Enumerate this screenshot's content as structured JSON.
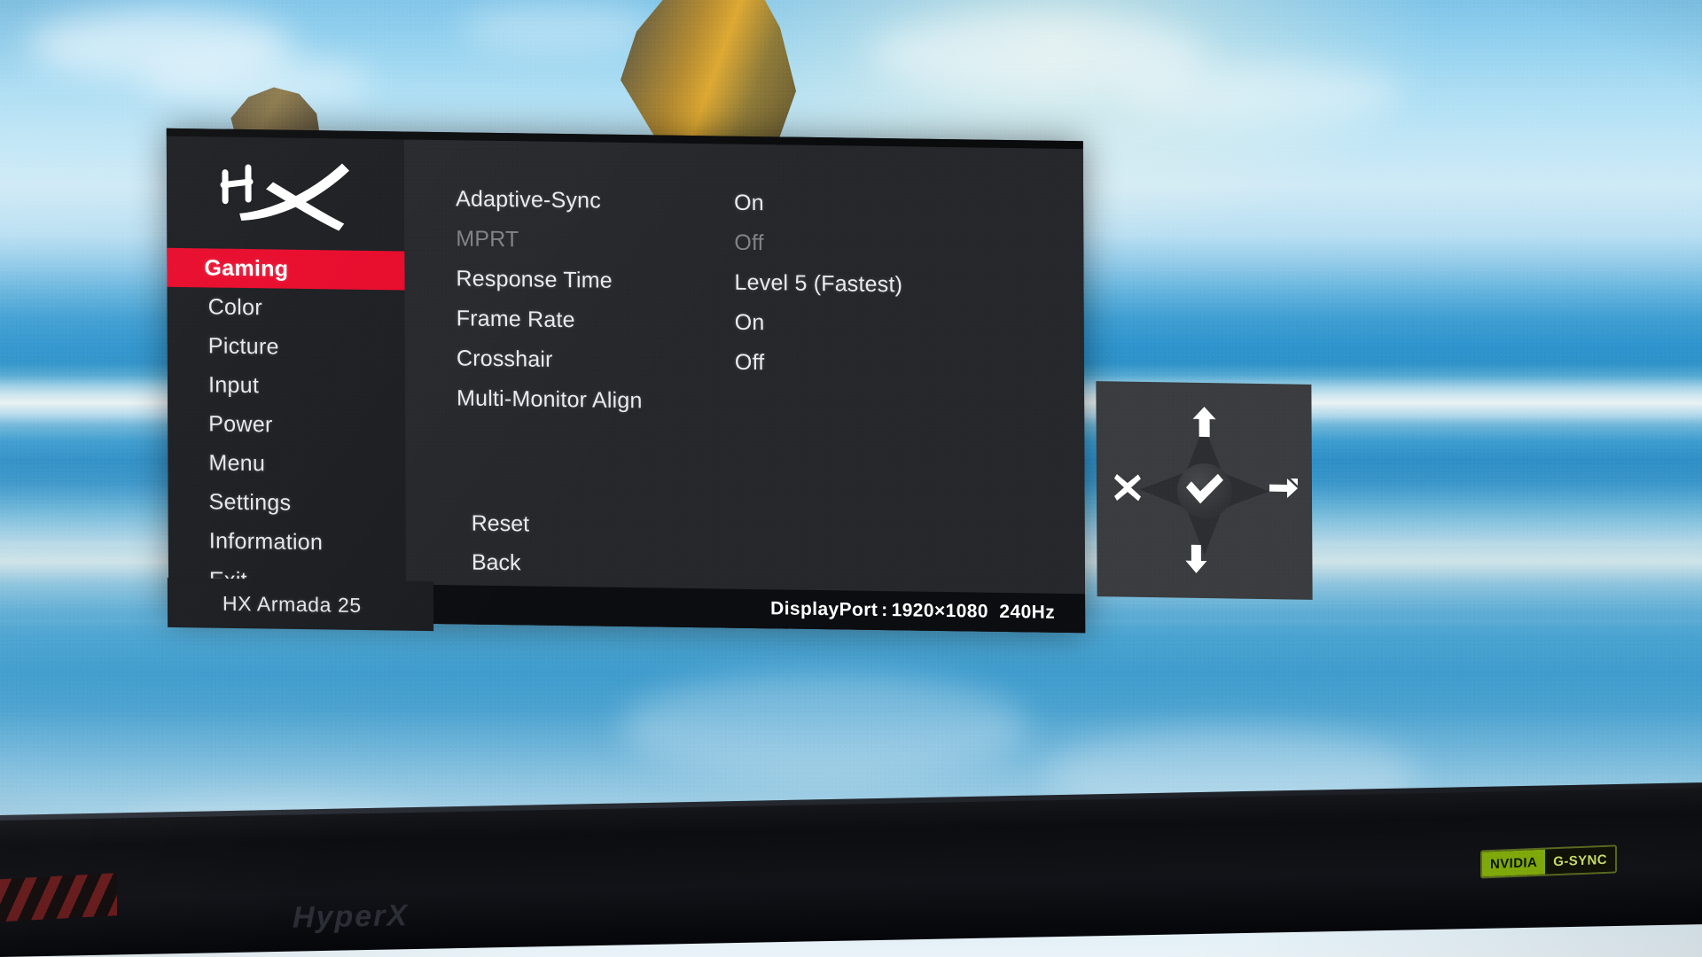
{
  "device": {
    "brand": "HyperX",
    "model_label": "HX Armada 25"
  },
  "sidebar": {
    "items": [
      {
        "label": "Gaming",
        "active": true
      },
      {
        "label": "Color",
        "active": false
      },
      {
        "label": "Picture",
        "active": false
      },
      {
        "label": "Input",
        "active": false
      },
      {
        "label": "Power",
        "active": false
      },
      {
        "label": "Menu",
        "active": false
      },
      {
        "label": "Settings",
        "active": false
      },
      {
        "label": "Information",
        "active": false
      },
      {
        "label": "Exit",
        "active": false
      }
    ]
  },
  "main": {
    "rows": [
      {
        "label": "Adaptive-Sync",
        "value": "On",
        "disabled": false
      },
      {
        "label": "MPRT",
        "value": "Off",
        "disabled": true
      },
      {
        "label": "Response Time",
        "value": "Level 5 (Fastest)",
        "disabled": false
      },
      {
        "label": "Frame Rate",
        "value": "On",
        "disabled": false
      },
      {
        "label": "Crosshair",
        "value": "Off",
        "disabled": false
      },
      {
        "label": "Multi-Monitor Align",
        "value": "",
        "disabled": false
      }
    ],
    "actions": [
      {
        "label": "Reset"
      },
      {
        "label": "Back"
      }
    ]
  },
  "status": {
    "source": "DisplayPort",
    "separator": ":",
    "resolution": "1920×1080",
    "refresh_rate": "240Hz"
  },
  "joystick": {
    "up": "▲",
    "down": "▼",
    "cancel": "✕",
    "enter": "➥",
    "confirm": "✔"
  },
  "bezel": {
    "brand_text": "HyperX",
    "gsync_vendor": "NVIDIA",
    "gsync_label": "G-SYNC"
  },
  "theme": {
    "accent_red": "#e8092a",
    "osd_bg": "#25272b",
    "sidebar_bg": "#1b1d21",
    "text": "#e9ebed",
    "text_disabled": "#7e8287",
    "statusbar_bg": "#0c0d10"
  }
}
